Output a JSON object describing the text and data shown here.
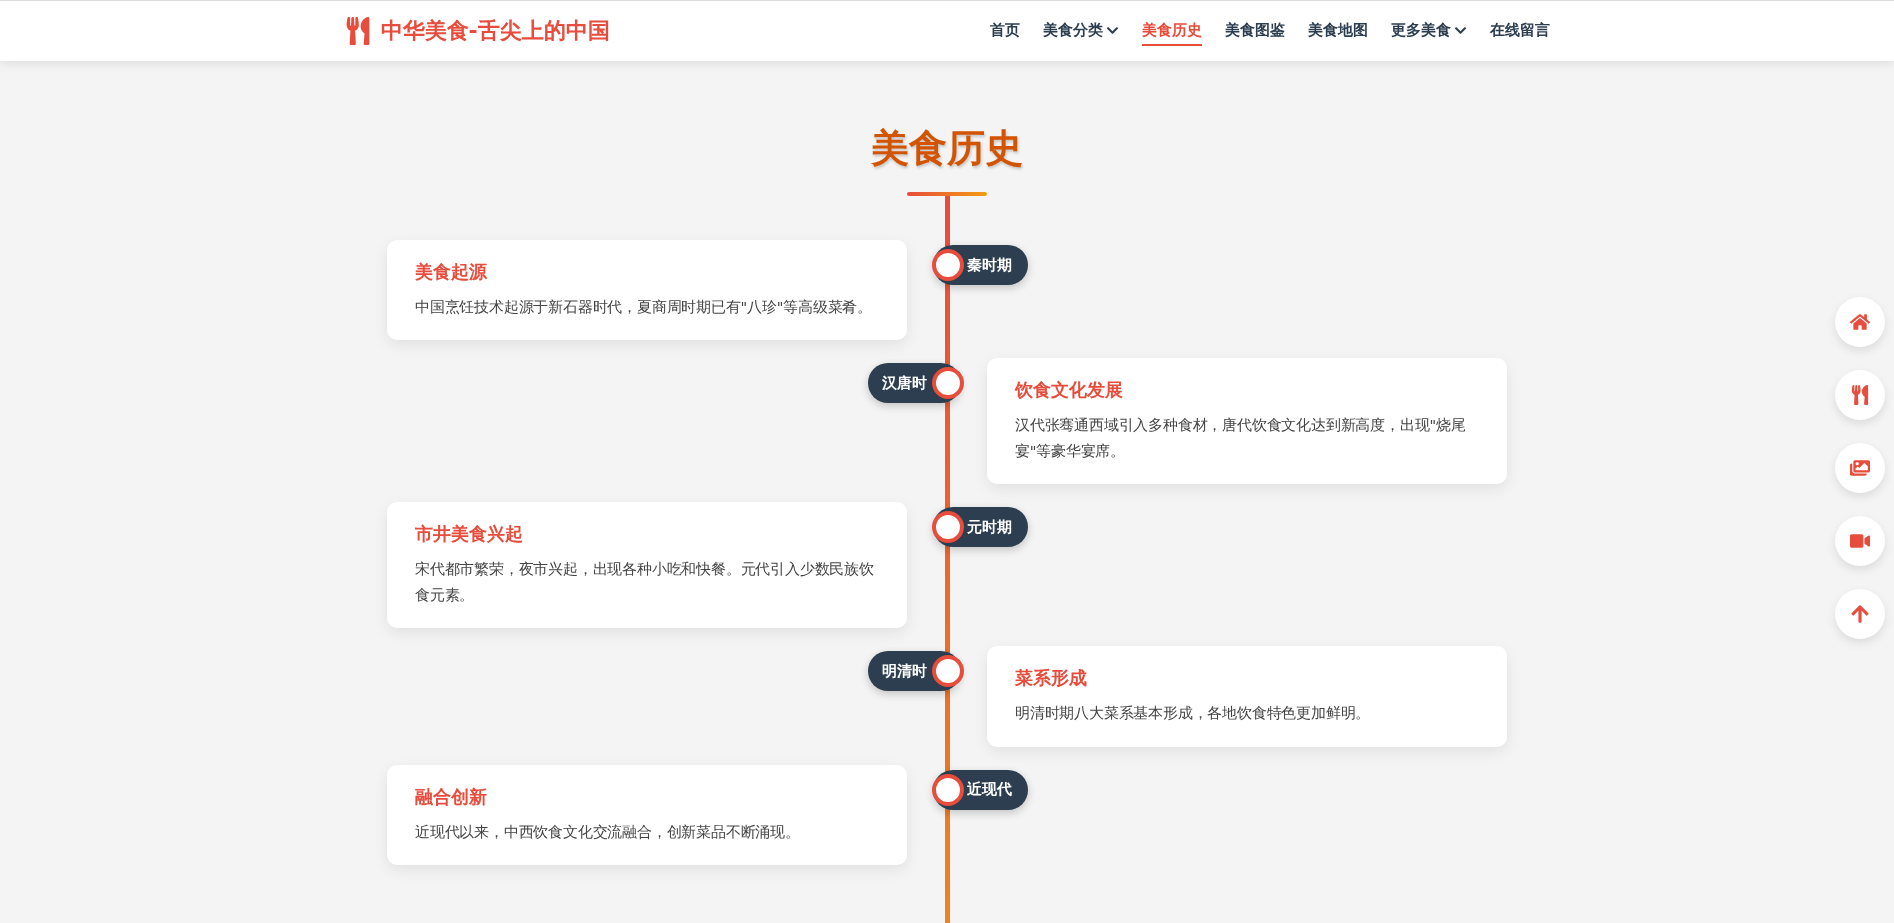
{
  "header": {
    "logo": "中华美食-舌尖上的中国",
    "nav": [
      {
        "label": "首页",
        "selected": false,
        "dropdown": false
      },
      {
        "label": "美食分类",
        "selected": false,
        "dropdown": true
      },
      {
        "label": "美食历史",
        "selected": true,
        "dropdown": false
      },
      {
        "label": "美食图鉴",
        "selected": false,
        "dropdown": false
      },
      {
        "label": "美食地图",
        "selected": false,
        "dropdown": false
      },
      {
        "label": "更多美食",
        "selected": false,
        "dropdown": true
      },
      {
        "label": "在线留言",
        "selected": false,
        "dropdown": false
      }
    ]
  },
  "section_title": "美食历史",
  "timeline": [
    {
      "kind": "left",
      "period": "秦时期",
      "title": "美食起源",
      "text": "中国烹饪技术起源于新石器时代，夏商周时期已有\"八珍\"等高级菜肴。"
    },
    {
      "kind": "right",
      "period": "汉唐时",
      "title": "饮食文化发展",
      "text": "汉代张骞通西域引入多种食材，唐代饮食文化达到新高度，出现\"烧尾宴\"等豪华宴席。"
    },
    {
      "kind": "left",
      "period": "元时期",
      "title": "市井美食兴起",
      "text": "宋代都市繁荣，夜市兴起，出现各种小吃和快餐。元代引入少数民族饮食元素。"
    },
    {
      "kind": "right",
      "period": "明清时",
      "title": "菜系形成",
      "text": "明清时期八大菜系基本形成，各地饮食特色更加鲜明。"
    },
    {
      "kind": "left",
      "period": "近现代",
      "title": "融合创新",
      "text": "近现代以来，中西饮食文化交流融合，创新菜品不断涌现。"
    }
  ]
}
